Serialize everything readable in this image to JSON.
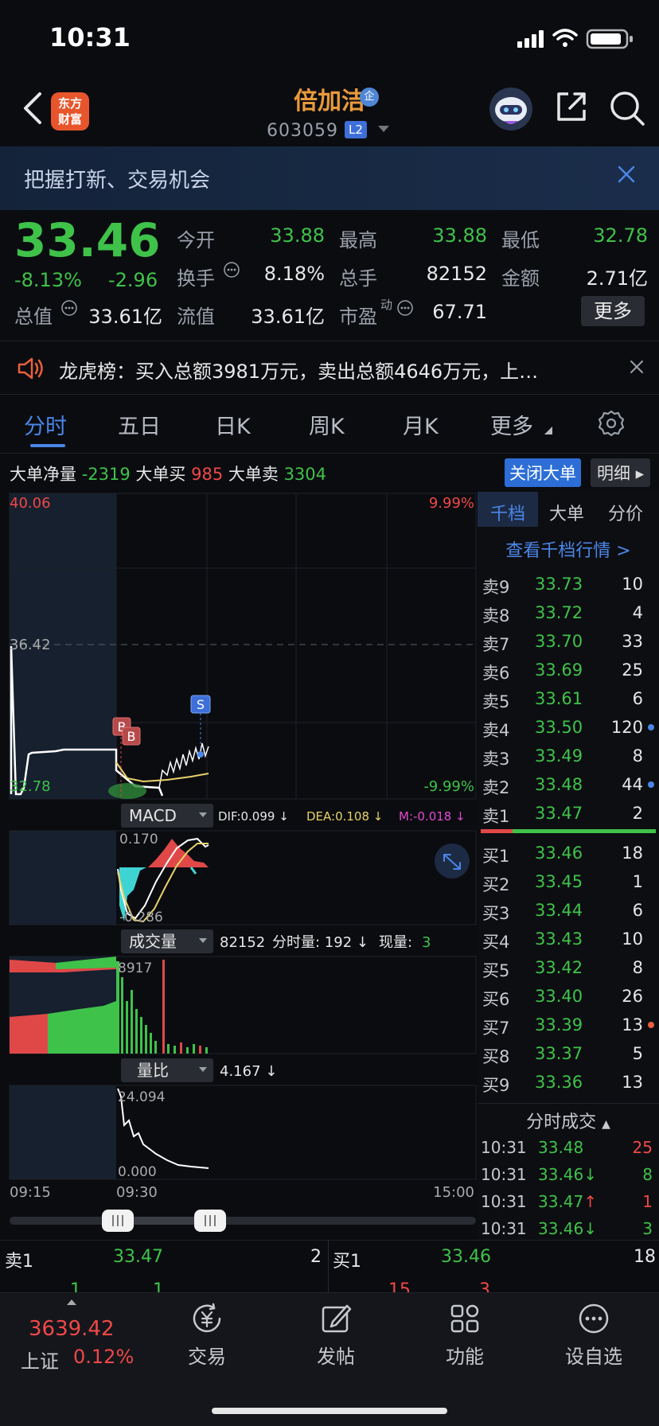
{
  "status": {
    "time": "10:31"
  },
  "nav": {
    "brand_line1": "东方",
    "brand_line2": "财富",
    "stock_name": "倍加洁",
    "qi_badge": "企",
    "code": "603059",
    "level": "L2"
  },
  "banner": {
    "text": "把握打新、交易机会"
  },
  "quote": {
    "price": "33.46",
    "pct": "-8.13%",
    "change": "-2.96",
    "open_label": "今开",
    "open": "33.88",
    "high_label": "最高",
    "high": "33.88",
    "low_label": "最低",
    "low": "32.78",
    "turnover_label": "换手",
    "turnover": "8.18%",
    "volume_label": "总手",
    "volume": "82152",
    "amount_label": "金额",
    "amount": "2.71亿",
    "mktcap_label": "总值",
    "mktcap": "33.61亿",
    "float_label": "流值",
    "float": "33.61亿",
    "pe_label": "市盈",
    "pe_sup": "动",
    "pe": "67.71",
    "more": "更多"
  },
  "dragon": {
    "text": "龙虎榜：买入总额3981万元，卖出总额4646万元，上…"
  },
  "tabs": [
    "分时",
    "五日",
    "日K",
    "周K",
    "月K",
    "更多"
  ],
  "bigorder": {
    "net_label": "大单净量",
    "net": "-2319",
    "buy_label": "大单买",
    "buy": "985",
    "sell_label": "大单卖",
    "sell": "3304",
    "close_btn": "关闭大单",
    "detail_btn": "明细"
  },
  "chart": {
    "price_top": "40.06",
    "price_mid": "36.42",
    "price_low": "32.78",
    "pct_top": "9.99%",
    "pct_low": "-9.99%",
    "marker_b": "B",
    "marker_s": "S",
    "macd_label": "MACD",
    "dif": "DIF:0.099 ↓",
    "dea": "DEA:0.108 ↓",
    "m": "M:-0.018 ↓",
    "macd_top": "0.170",
    "macd_low": "-0.286",
    "vol_label": "成交量",
    "vol_info_total": "82152",
    "vol_info_min": "分时量: 192 ↓",
    "vol_info_now_label": "现量:",
    "vol_info_now": "3",
    "vol_top": "8917",
    "ratio_label": "量比",
    "ratio_val": "4.167 ↓",
    "ratio_top": "24.094",
    "ratio_low": "0.000",
    "t_start": "09:15",
    "t_open": "09:30",
    "t_end": "15:00"
  },
  "book": {
    "tabs": [
      "千档",
      "大单",
      "分价"
    ],
    "view_link": "查看千档行情 >",
    "asks": [
      {
        "label": "卖9",
        "price": "33.73",
        "vol": "10",
        "dot": ""
      },
      {
        "label": "卖8",
        "price": "33.72",
        "vol": "4",
        "dot": ""
      },
      {
        "label": "卖7",
        "price": "33.70",
        "vol": "33",
        "dot": ""
      },
      {
        "label": "卖6",
        "price": "33.69",
        "vol": "25",
        "dot": ""
      },
      {
        "label": "卖5",
        "price": "33.61",
        "vol": "6",
        "dot": ""
      },
      {
        "label": "卖4",
        "price": "33.50",
        "vol": "120",
        "dot": "#4a86e8"
      },
      {
        "label": "卖3",
        "price": "33.49",
        "vol": "8",
        "dot": ""
      },
      {
        "label": "卖2",
        "price": "33.48",
        "vol": "44",
        "dot": "#4a86e8"
      },
      {
        "label": "卖1",
        "price": "33.47",
        "vol": "2",
        "dot": ""
      }
    ],
    "bids": [
      {
        "label": "买1",
        "price": "33.46",
        "vol": "18",
        "dot": ""
      },
      {
        "label": "买2",
        "price": "33.45",
        "vol": "1",
        "dot": ""
      },
      {
        "label": "买3",
        "price": "33.44",
        "vol": "6",
        "dot": ""
      },
      {
        "label": "买4",
        "price": "33.43",
        "vol": "10",
        "dot": ""
      },
      {
        "label": "买5",
        "price": "33.42",
        "vol": "8",
        "dot": ""
      },
      {
        "label": "买6",
        "price": "33.40",
        "vol": "26",
        "dot": ""
      },
      {
        "label": "买7",
        "price": "33.39",
        "vol": "13",
        "dot": "#e8603c"
      },
      {
        "label": "买8",
        "price": "33.37",
        "vol": "5",
        "dot": ""
      },
      {
        "label": "买9",
        "price": "33.36",
        "vol": "13",
        "dot": ""
      }
    ],
    "trades_title": "分时成交",
    "trades": [
      {
        "time": "10:31",
        "price": "33.48",
        "arrow": "",
        "vol": "25",
        "vcolor": "#f04848"
      },
      {
        "time": "10:31",
        "price": "33.46↓",
        "arrow": "",
        "vol": "8",
        "vcolor": "#3fc24a"
      },
      {
        "time": "10:31",
        "price": "33.47",
        "arrow": "↑",
        "vol": "1",
        "vcolor": "#f04848"
      },
      {
        "time": "10:31",
        "price": "33.46↓",
        "arrow": "",
        "vol": "3",
        "vcolor": "#3fc24a"
      }
    ]
  },
  "strip": {
    "ask_label": "卖1",
    "ask_price": "33.47",
    "ask_vol": "2",
    "bid_label": "买1",
    "bid_price": "33.46",
    "bid_vol": "18",
    "row2": [
      "1",
      "1",
      "15",
      "3"
    ]
  },
  "bottom": {
    "index_value": "3639.42",
    "index_name": "上证",
    "index_pct": "0.12%",
    "items": [
      "交易",
      "发帖",
      "功能",
      "设自选"
    ]
  },
  "colors": {
    "up": "#f04848",
    "down": "#3fc24a",
    "accent": "#4a86e8",
    "brand": "#e89a3c"
  }
}
